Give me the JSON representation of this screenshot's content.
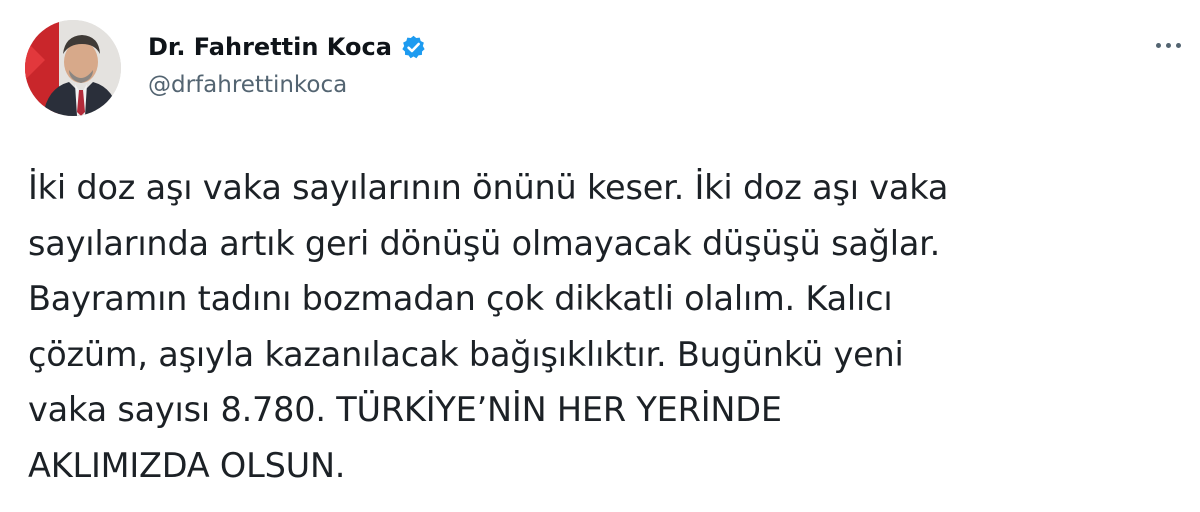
{
  "author": {
    "display_name": "Dr. Fahrettin Koca",
    "handle": "@drfahrettinkoca",
    "verified_icon": "verified-badge-icon",
    "verified_color": "#1d9bf0"
  },
  "actions": {
    "more_icon": "more-horizontal-icon"
  },
  "tweet": {
    "lines": [
      "İki doz aşı vaka sayılarının önünü keser. İki doz aşı vaka",
      "sayılarında artık geri dönüşü olmayacak düşüşü sağlar.",
      "Bayramın tadını bozmadan çok dikkatli olalım. Kalıcı",
      "çözüm, aşıyla kazanılacak bağışıklıktır. Bugünkü yeni",
      "vaka sayısı 8.780. TÜRKİYE’NİN HER YERİNDE",
      "AKLIMIZDA OLSUN."
    ]
  },
  "colors": {
    "text_primary": "#0f1419",
    "text_secondary": "#536471",
    "background": "#ffffff"
  }
}
